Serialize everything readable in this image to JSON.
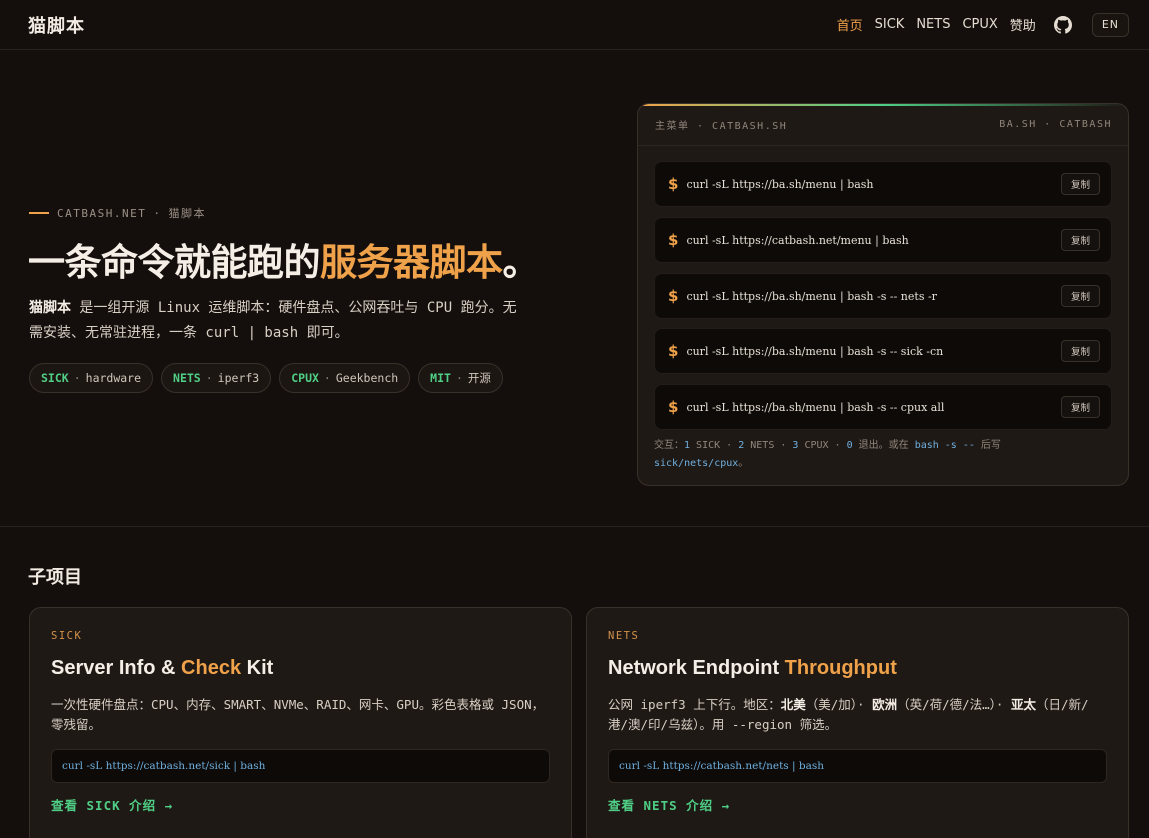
{
  "nav": {
    "brand": "猫脚本",
    "links": [
      "首页",
      "SICK",
      "NETS",
      "CPUX",
      "赞助"
    ],
    "github_icon": "github-icon",
    "lang": "EN"
  },
  "hero": {
    "eyebrow_site": "CATBASH.NET",
    "eyebrow_sep": "·",
    "eyebrow_name": "猫脚本",
    "title_main": "一条命令就能跑的",
    "title_accent": "服务器脚本",
    "title_end": "。",
    "desc_bold": "猫脚本",
    "desc_rest": " 是一组开源 Linux 运维脚本：硬件盘点、公网吞吐与 CPU 跑分。无需安装、无常驻进程，一条 curl | bash 即可。",
    "chips": [
      {
        "key": "SICK",
        "sep": "·",
        "val": "hardware"
      },
      {
        "key": "NETS",
        "sep": "·",
        "val": "iperf3"
      },
      {
        "key": "CPUX",
        "sep": "·",
        "val": "Geekbench"
      },
      {
        "key": "MIT",
        "sep": "·",
        "val": "开源"
      }
    ]
  },
  "terminal": {
    "header_left": "主菜单 · CATBASH.SH",
    "header_right": "BA.SH · CATBASH",
    "prompt": "$",
    "copy_label": "复制",
    "commands": [
      "curl -sL https://ba.sh/menu | bash",
      "curl -sL https://catbash.net/menu | bash",
      "curl -sL https://ba.sh/menu | bash -s -- nets -r",
      "curl -sL https://ba.sh/menu | bash -s -- sick -cn",
      "curl -sL https://ba.sh/menu | bash -s -- cpux all"
    ],
    "footer": {
      "p1": "交互：",
      "n1": "1",
      "t1": " SICK · ",
      "n2": "2",
      "t2": " NETS · ",
      "n3": "3",
      "t3": " CPUX · ",
      "n0": "0",
      "t0": " 退出。或在 ",
      "code1": "bash -s --",
      "t4": " 后写",
      "code2": "sick/nets/cpux",
      "t5": "。"
    }
  },
  "subprojects": {
    "title": "子项目",
    "cards": [
      {
        "tag": "SICK",
        "title_a": "Server Info & ",
        "title_accent": "Check",
        "title_b": " Kit",
        "desc": "一次性硬件盘点：CPU、内存、SMART、NVMe、RAID、网卡、GPU。彩色表格或 JSON，零残留。",
        "cmd": "curl -sL https://catbash.net/sick | bash",
        "link": "查看 SICK 介绍 →"
      },
      {
        "tag": "NETS",
        "title_a": "Network Endpoint ",
        "title_accent": "Throughput",
        "title_b": "",
        "desc_a": "公网 iperf3 上下行。地区：",
        "desc_b1": "北美",
        "desc_c1": "（美/加）· ",
        "desc_b2": "欧洲",
        "desc_c2": "（英/荷/德/法…）· ",
        "desc_b3": "亚太",
        "desc_c3": "（日/新/港/澳/印/乌兹）。用 --region 筛选。",
        "cmd": "curl -sL https://catbash.net/nets | bash",
        "link": "查看 NETS 介绍 →"
      }
    ]
  }
}
